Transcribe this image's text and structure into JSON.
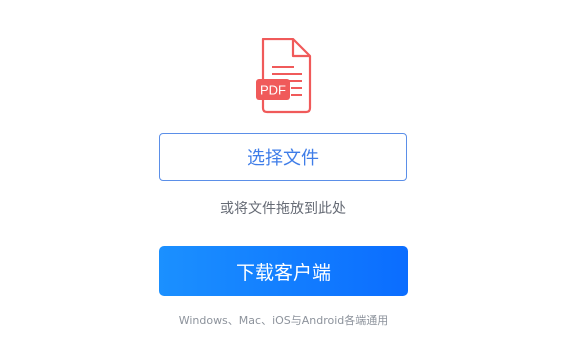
{
  "upload": {
    "icon": "pdf-file-icon",
    "icon_badge": "PDF",
    "icon_color": "#f05a5a",
    "select_button_label": "选择文件",
    "drop_hint": "或将文件拖放到此处"
  },
  "download": {
    "button_label": "下载客户端",
    "platform_note": "Windows、Mac、iOS与Android各端通用",
    "button_color": "#0b6dff"
  }
}
